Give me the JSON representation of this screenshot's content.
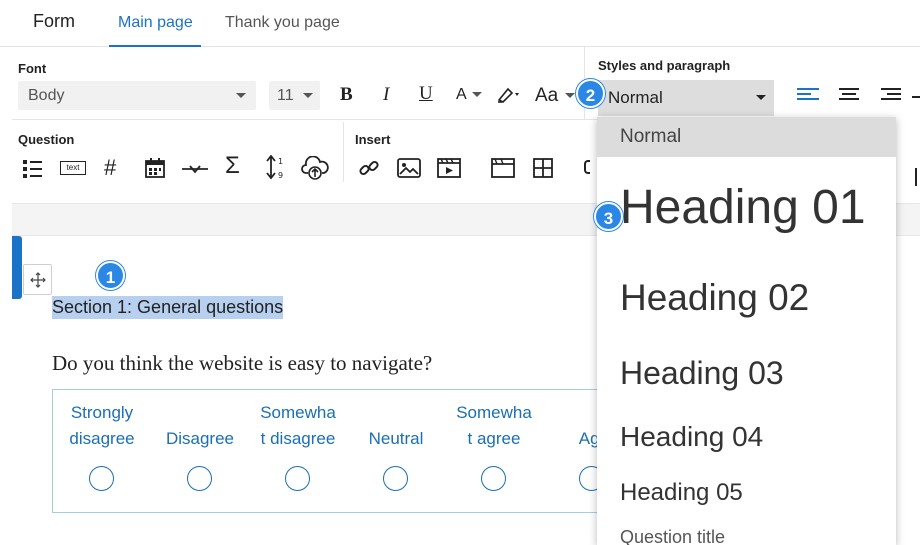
{
  "header": {
    "title": "Form",
    "tabs": [
      {
        "label": "Main page",
        "active": true
      },
      {
        "label": "Thank you page",
        "active": false
      }
    ]
  },
  "ribbon": {
    "font_section": {
      "label": "Font",
      "font_family_value": "Body",
      "font_size_value": "11",
      "bold": "B",
      "italic": "I",
      "underline": "U",
      "font_color": "A",
      "case": "Aa"
    },
    "styles_section": {
      "label": "Styles and paragraph",
      "style_value": "Normal"
    },
    "question_section": {
      "label": "Question",
      "text_icon_label": "text",
      "number_icon": "#",
      "sum_icon": "Σ"
    },
    "insert_section": {
      "label": "Insert"
    }
  },
  "content": {
    "section_title": "Section 1: General questions",
    "question": "Do you think the website is easy to navigate?",
    "likert_options": [
      {
        "line1": "Strongly",
        "line2": "disagree"
      },
      {
        "line1": "",
        "line2": "Disagree"
      },
      {
        "line1": "Somewha",
        "line2": "t disagree"
      },
      {
        "line1": "",
        "line2": "Neutral"
      },
      {
        "line1": "Somewha",
        "line2": "t agree"
      },
      {
        "line1": "",
        "line2": "Agr"
      }
    ]
  },
  "style_dropdown": {
    "items": [
      "Normal",
      "Heading 01",
      "Heading 02",
      "Heading 03",
      "Heading 04",
      "Heading 05",
      "Question title"
    ],
    "selected": "Normal"
  },
  "callouts": [
    "1",
    "2",
    "3"
  ],
  "colors": {
    "accent": "#1a73c7",
    "badge": "#2b87e6",
    "highlight": "#b7d0ef",
    "likert_text": "#1a6fb4"
  }
}
